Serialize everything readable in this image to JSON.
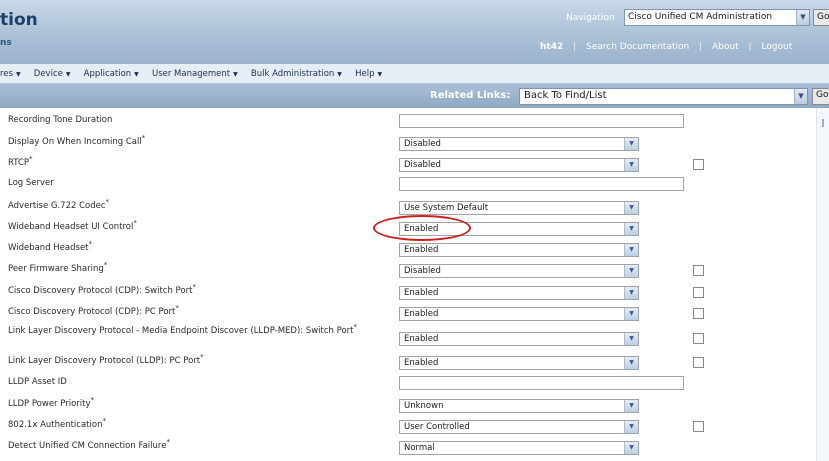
{
  "header": {
    "app_title": "tion",
    "app_subtitle": "ns",
    "navigation_label": "Navigation",
    "navigation_value": "Cisco Unified CM Administration",
    "go_label": "Go",
    "user": "ht42",
    "links": [
      "Search Documentation",
      "About",
      "Logout"
    ]
  },
  "menu": [
    "res",
    "Device",
    "Application",
    "User Management",
    "Bulk Administration",
    "Help"
  ],
  "related_links": {
    "label": "Related Links:",
    "value": "Back To Find/List",
    "go_label": "Go"
  },
  "fields": [
    {
      "label": "Recording Tone Duration",
      "required": false,
      "type": "text",
      "value": ""
    },
    {
      "label": "Display On When Incoming Call",
      "required": true,
      "type": "select",
      "value": "Disabled"
    },
    {
      "label": "RTCP",
      "required": true,
      "type": "select",
      "value": "Disabled",
      "checkbox": true
    },
    {
      "label": "Log Server",
      "required": false,
      "type": "text",
      "value": ""
    },
    {
      "label": "Advertise G.722 Codec",
      "required": true,
      "type": "select",
      "value": "Use System Default"
    },
    {
      "label": "Wideband Headset UI Control",
      "required": true,
      "type": "select",
      "value": "Enabled"
    },
    {
      "label": "Wideband Headset",
      "required": true,
      "type": "select",
      "value": "Enabled"
    },
    {
      "label": "Peer Firmware Sharing",
      "required": true,
      "type": "select",
      "value": "Disabled",
      "checkbox": true
    },
    {
      "label": "Cisco Discovery Protocol (CDP): Switch Port",
      "required": true,
      "type": "select",
      "value": "Enabled",
      "checkbox": true
    },
    {
      "label": "Cisco Discovery Protocol (CDP): PC Port",
      "required": true,
      "type": "select",
      "value": "Enabled",
      "checkbox": true
    },
    {
      "label": "Link Layer Discovery Protocol - Media Endpoint Discover (LLDP-MED): Switch Port",
      "required": true,
      "type": "select",
      "value": "Enabled",
      "checkbox": true
    },
    {
      "label": "Link Layer Discovery Protocol (LLDP): PC Port",
      "required": true,
      "type": "select",
      "value": "Enabled",
      "checkbox": true
    },
    {
      "label": "LLDP Asset ID",
      "required": false,
      "type": "text",
      "value": ""
    },
    {
      "label": "LLDP Power Priority",
      "required": true,
      "type": "select",
      "value": "Unknown"
    },
    {
      "label": "802.1x Authentication",
      "required": true,
      "type": "select",
      "value": "User Controlled",
      "checkbox": true
    },
    {
      "label": "Detect Unified CM Connection Failure",
      "required": true,
      "type": "select",
      "value": "Normal"
    }
  ],
  "colors": {
    "header": "#a8bfd6",
    "menubar": "#e6edf5",
    "related_bar": "#8ea9c5",
    "annotation": "#cc1f1f"
  },
  "icons": {
    "dropdown": "chevron-down-icon"
  }
}
